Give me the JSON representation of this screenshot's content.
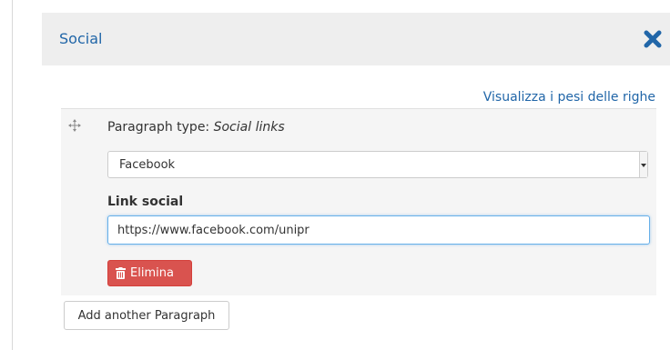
{
  "panel": {
    "title": "Social",
    "close_icon": "close-x-icon",
    "accent_color": "#2166a8"
  },
  "weights_link": "Visualizza i pesi delle righe",
  "paragraph": {
    "type_prefix": "Paragraph type:",
    "type_name": "Social links",
    "network_select": {
      "selected": "Facebook"
    },
    "link_field": {
      "label": "Link social",
      "value": "https://www.facebook.com/unipr"
    },
    "delete_button": {
      "label": "Elimina",
      "icon": "trash-icon",
      "color": "#d9534f"
    }
  },
  "add_button": "Add another Paragraph"
}
